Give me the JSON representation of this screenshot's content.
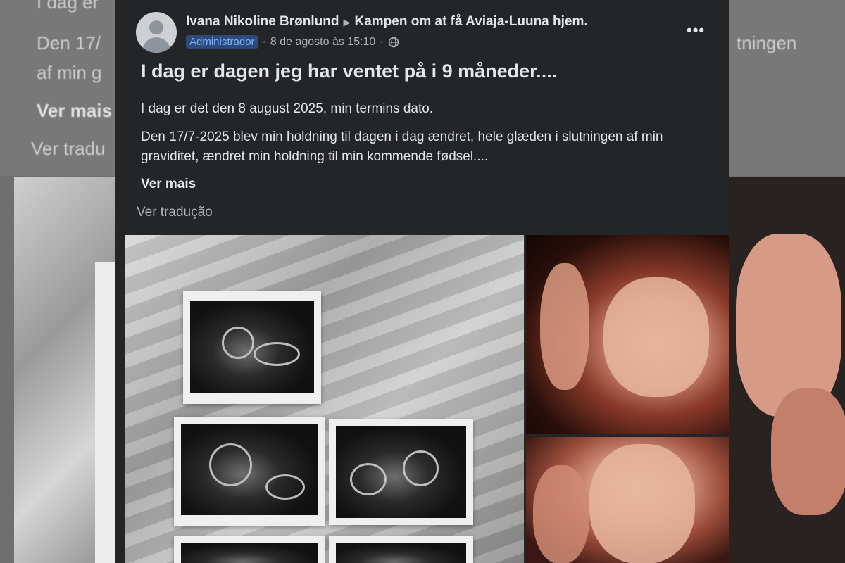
{
  "background": {
    "line1": "I dag er",
    "line2_left": "Den 17/",
    "line2_right": "tningen",
    "line3": "af min g",
    "ver_mais": "Ver mais",
    "ver_traducao": "Ver tradu"
  },
  "post": {
    "author": "Ivana Nikoline Brønlund",
    "group": "Kampen om at få Aviaja-Luuna hjem.",
    "badge": "Administrador",
    "date": "8 de agosto às 15:10",
    "title": "I dag er dagen jeg har ventet på i 9 måneder....",
    "paragraph1": "I dag er det den 8 august 2025, min termins dato.",
    "paragraph2": "Den 17/7-2025 blev min holdning til dagen i dag ændret, hele glæden i slutningen af min graviditet, ændret min holdning til min kommende fødsel....",
    "see_more": "Ver mais",
    "translate": "Ver tradução",
    "more_icon": "more-horizontal-icon",
    "privacy_icon": "globe-icon"
  },
  "colors": {
    "card_bg": "#242526",
    "text_primary": "#e4e6eb",
    "text_secondary": "#b0b3b8",
    "badge_bg": "#2d4a7a",
    "badge_text": "#7fb0ff"
  }
}
